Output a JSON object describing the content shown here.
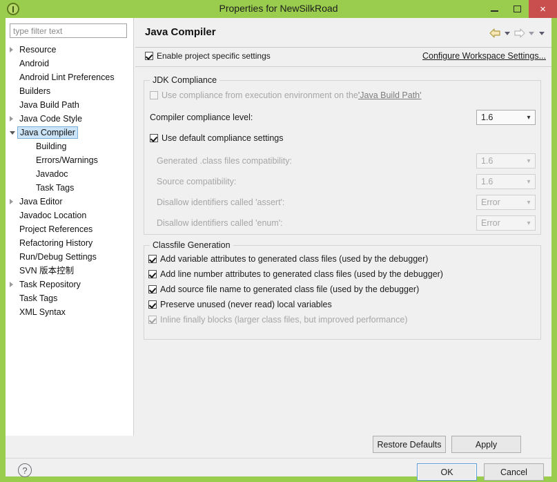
{
  "window": {
    "title": "Properties for NewSilkRoad",
    "icon": "eclipse-icon",
    "minimize_label": "Minimize",
    "maximize_label": "Maximize",
    "close_label": "×",
    "titlebar_color": "#9ACD4E",
    "close_color": "#c94f4f"
  },
  "sidebar": {
    "filter": {
      "value": "",
      "placeholder": "type filter text"
    },
    "items": [
      {
        "label": "Resource",
        "indent": 0,
        "arrow": "collapsed",
        "selected": false
      },
      {
        "label": "Android",
        "indent": 0,
        "arrow": "none",
        "selected": false
      },
      {
        "label": "Android Lint Preferences",
        "indent": 0,
        "arrow": "none",
        "selected": false
      },
      {
        "label": "Builders",
        "indent": 0,
        "arrow": "none",
        "selected": false
      },
      {
        "label": "Java Build Path",
        "indent": 0,
        "arrow": "none",
        "selected": false
      },
      {
        "label": "Java Code Style",
        "indent": 0,
        "arrow": "collapsed",
        "selected": false
      },
      {
        "label": "Java Compiler",
        "indent": 0,
        "arrow": "expanded",
        "selected": true
      },
      {
        "label": "Building",
        "indent": 1,
        "arrow": "none",
        "selected": false
      },
      {
        "label": "Errors/Warnings",
        "indent": 1,
        "arrow": "none",
        "selected": false
      },
      {
        "label": "Javadoc",
        "indent": 1,
        "arrow": "none",
        "selected": false
      },
      {
        "label": "Task Tags",
        "indent": 1,
        "arrow": "none",
        "selected": false
      },
      {
        "label": "Java Editor",
        "indent": 0,
        "arrow": "collapsed",
        "selected": false
      },
      {
        "label": "Javadoc Location",
        "indent": 0,
        "arrow": "none",
        "selected": false
      },
      {
        "label": "Project References",
        "indent": 0,
        "arrow": "none",
        "selected": false
      },
      {
        "label": "Refactoring History",
        "indent": 0,
        "arrow": "none",
        "selected": false
      },
      {
        "label": "Run/Debug Settings",
        "indent": 0,
        "arrow": "none",
        "selected": false
      },
      {
        "label": "SVN 版本控制",
        "indent": 0,
        "arrow": "none",
        "selected": false
      },
      {
        "label": "Task Repository",
        "indent": 0,
        "arrow": "collapsed",
        "selected": false
      },
      {
        "label": "Task Tags",
        "indent": 0,
        "arrow": "none",
        "selected": false
      },
      {
        "label": "XML Syntax",
        "indent": 0,
        "arrow": "none",
        "selected": false
      }
    ],
    "scrollbar": {
      "left_arrow": "‹",
      "right_arrow": "›"
    }
  },
  "main": {
    "title": "Java Compiler",
    "nav": {
      "back_label": "Back",
      "back_menu": "▾",
      "forward_label": "Forward",
      "forward_menu": "▾",
      "view_menu": "▾"
    },
    "enable_specific": {
      "label": "Enable project specific settings",
      "checked": true,
      "enabled": true
    },
    "configure_workspace_link": "Configure Workspace Settings...",
    "jdk_compliance": {
      "legend": "JDK Compliance",
      "use_execution_env": {
        "prefix": "Use compliance from execution environment on the ",
        "link": "'Java Build Path'",
        "checked": false,
        "enabled": false
      },
      "compliance_level": {
        "label": "Compiler compliance level:",
        "value": "1.6",
        "enabled": true
      },
      "use_default": {
        "label": "Use default compliance settings",
        "checked": true,
        "enabled": true
      },
      "generated_class": {
        "label": "Generated .class files compatibility:",
        "value": "1.6",
        "enabled": false
      },
      "source_compat": {
        "label": "Source compatibility:",
        "value": "1.6",
        "enabled": false
      },
      "disallow_assert": {
        "label": "Disallow identifiers called 'assert':",
        "value": "Error",
        "enabled": false
      },
      "disallow_enum": {
        "label": "Disallow identifiers called 'enum':",
        "value": "Error",
        "enabled": false
      }
    },
    "classfile_generation": {
      "legend": "Classfile Generation",
      "options": [
        {
          "label": "Add variable attributes to generated class files (used by the debugger)",
          "checked": true,
          "enabled": true
        },
        {
          "label": "Add line number attributes to generated class files (used by the debugger)",
          "checked": true,
          "enabled": true
        },
        {
          "label": "Add source file name to generated class file (used by the debugger)",
          "checked": true,
          "enabled": true
        },
        {
          "label": "Preserve unused (never read) local variables",
          "checked": true,
          "enabled": true
        },
        {
          "label": "Inline finally blocks (larger class files, but improved performance)",
          "checked": true,
          "enabled": false
        }
      ]
    }
  },
  "footer": {
    "restore_defaults": "Restore Defaults",
    "apply": "Apply",
    "ok": "OK",
    "cancel": "Cancel",
    "help": "?"
  }
}
